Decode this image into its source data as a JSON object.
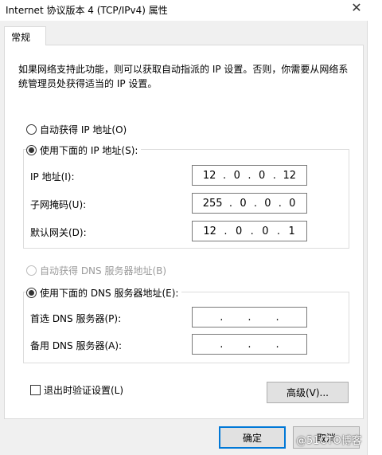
{
  "window": {
    "title": "Internet 协议版本 4 (TCP/IPv4) 属性",
    "close_glyph": "✕"
  },
  "tabs": [
    {
      "label": "常规"
    }
  ],
  "description": "如果网络支持此功能，则可以获取自动指派的 IP 设置。否则，你需要从网络系统管理员处获得适当的 IP 设置。",
  "ip_section": {
    "auto_label": "自动获得 IP 地址(O)",
    "manual_label": "使用下面的 IP 地址(S):",
    "selected": "manual",
    "fields": [
      {
        "label": "IP 地址(I):",
        "octets": [
          "12",
          "0",
          "0",
          "12"
        ]
      },
      {
        "label": "子网掩码(U):",
        "octets": [
          "255",
          "0",
          "0",
          "0"
        ]
      },
      {
        "label": "默认网关(D):",
        "octets": [
          "12",
          "0",
          "0",
          "1"
        ]
      }
    ]
  },
  "dns_section": {
    "auto_label": "自动获得 DNS 服务器地址(B)",
    "auto_disabled": true,
    "manual_label": "使用下面的 DNS 服务器地址(E):",
    "selected": "manual",
    "fields": [
      {
        "label": "首选 DNS 服务器(P):",
        "octets": [
          "",
          "",
          "",
          ""
        ]
      },
      {
        "label": "备用 DNS 服务器(A):",
        "octets": [
          "",
          "",
          "",
          ""
        ]
      }
    ]
  },
  "validate_on_exit": {
    "label": "退出时验证设置(L)",
    "checked": false
  },
  "buttons": {
    "advanced": "高级(V)...",
    "ok": "确定",
    "cancel": "取消"
  },
  "watermark": "@51CTO博客",
  "colors": {
    "accent": "#0078d7",
    "panel_bg": "#ffffff",
    "window_bg": "#f0f0f0",
    "disabled_text": "#9b9b9b"
  }
}
